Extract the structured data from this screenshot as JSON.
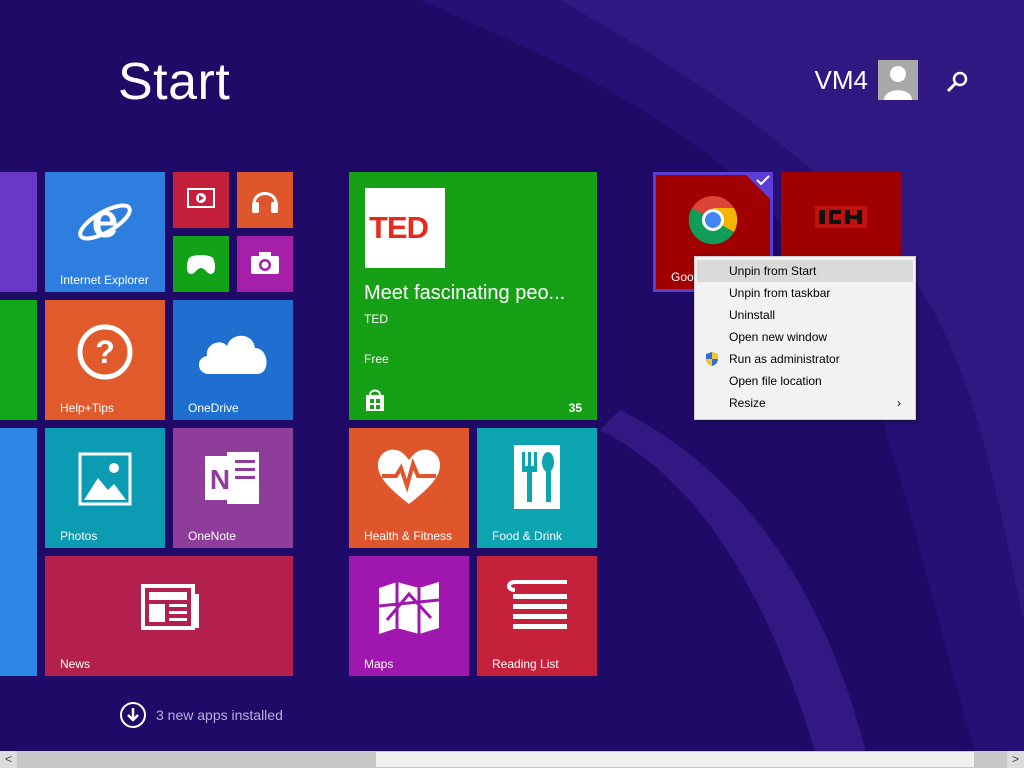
{
  "screen": {
    "title": "Start"
  },
  "user": {
    "name": "VM4"
  },
  "icons": {
    "search": "search-icon",
    "avatar": "user-avatar-icon"
  },
  "tiles": {
    "ie": {
      "label": "Internet Explorer",
      "color": "#2e7ee0"
    },
    "help": {
      "label": "Help+Tips",
      "color": "#e05a2c"
    },
    "onedrive": {
      "label": "OneDrive",
      "color": "#1e6fcf"
    },
    "photos": {
      "label": "Photos",
      "color": "#0b9bb3"
    },
    "onenote": {
      "label": "OneNote",
      "color": "#8e3d9a"
    },
    "news": {
      "label": "News",
      "color": "#b3204d"
    },
    "ted": {
      "title": "Meet fascinating peo...",
      "publisher": "TED",
      "price": "Free",
      "count": "35",
      "logo": "TED",
      "color": "#16a015"
    },
    "health": {
      "label": "Health & Fitness",
      "color": "#e0562c"
    },
    "food": {
      "label": "Food & Drink",
      "color": "#0ba4b0"
    },
    "maps": {
      "label": "Maps",
      "color": "#a017b0"
    },
    "reading": {
      "label": "Reading List",
      "color": "#c5213a"
    },
    "chrome": {
      "label": "Goog",
      "color": "#a00000"
    }
  },
  "context_menu": {
    "items": [
      {
        "label": "Unpin from Start"
      },
      {
        "label": "Unpin from taskbar"
      },
      {
        "label": "Uninstall"
      },
      {
        "label": "Open new window"
      },
      {
        "label": "Run as administrator"
      },
      {
        "label": "Open file location"
      },
      {
        "label": "Resize",
        "submenu_arrow": "›"
      }
    ]
  },
  "footer": {
    "new_apps": "3 new apps installed"
  },
  "scrollbar": {
    "left": "<",
    "right": ">"
  }
}
